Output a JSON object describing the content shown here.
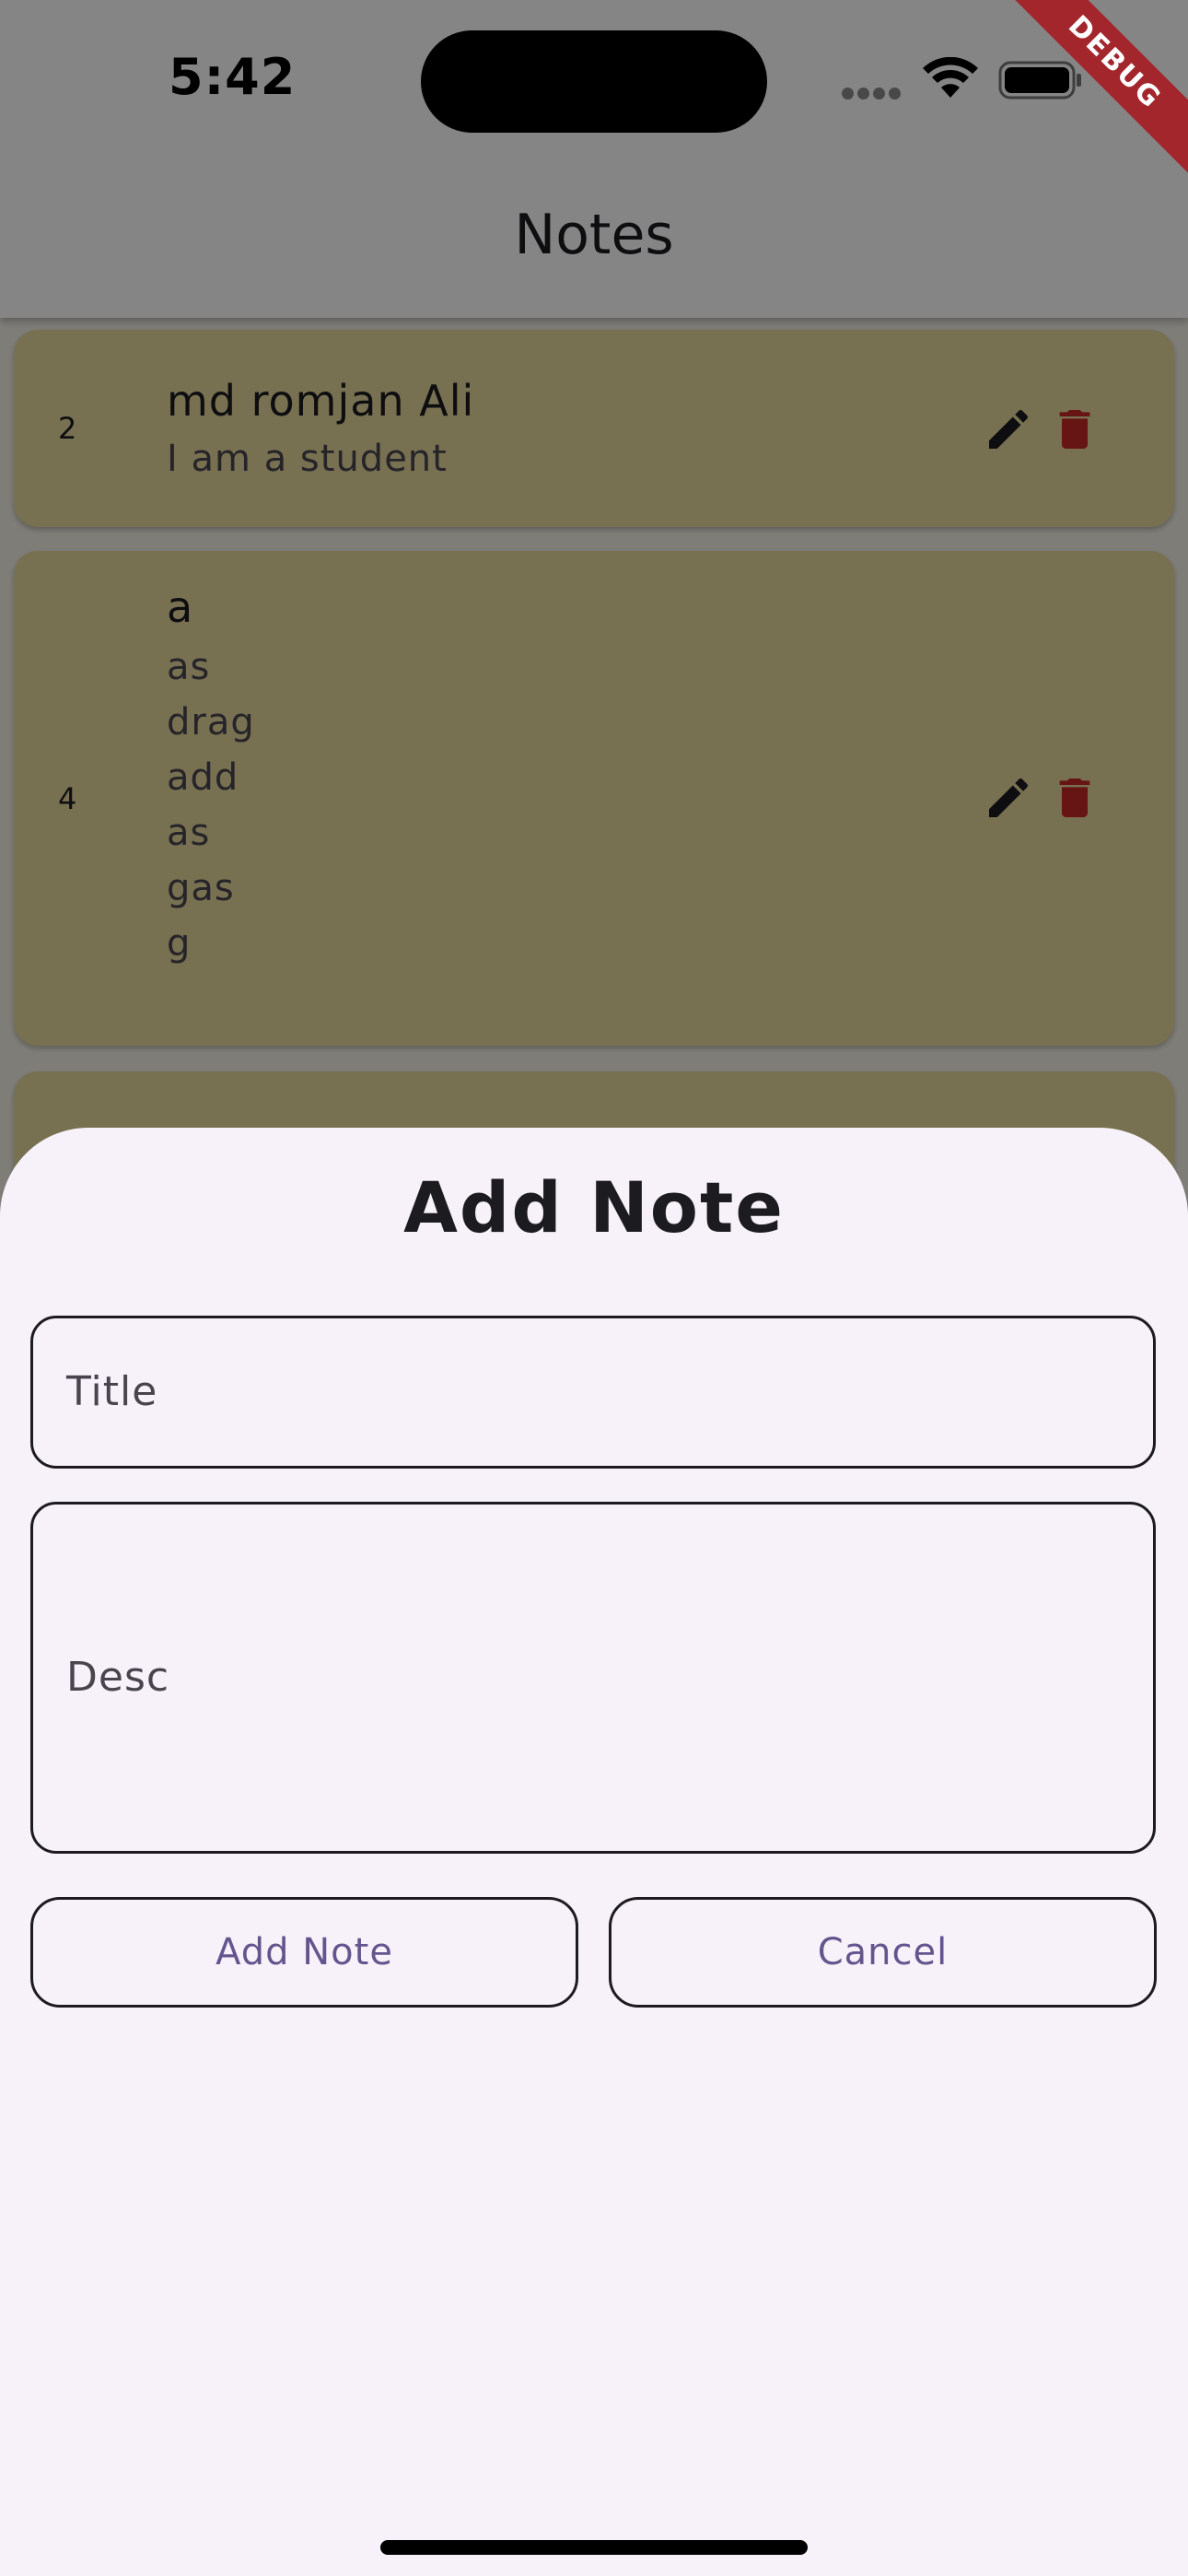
{
  "status_bar": {
    "time": "5:42",
    "debug_label": "DEBUG"
  },
  "app_bar": {
    "title": "Notes"
  },
  "notes": [
    {
      "index": "2",
      "title": "md romjan Ali",
      "desc": "I am a student"
    },
    {
      "index": "4",
      "title": "a",
      "desc": "as\ndrag\nadd\nas\ngas\ng"
    }
  ],
  "sheet": {
    "title": "Add Note",
    "title_placeholder": "Title",
    "desc_placeholder": "Desc",
    "add_button": "Add Note",
    "cancel_button": "Cancel"
  },
  "colors": {
    "card": "#e4d69c",
    "delete_icon": "#c62828",
    "button_text": "#65558f",
    "sheet_bg": "#f7f2f9"
  }
}
